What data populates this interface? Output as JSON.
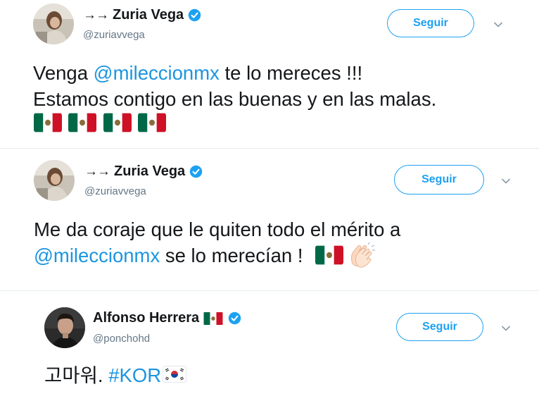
{
  "tweets": [
    {
      "prefix": "→→",
      "name": "Zuria Vega",
      "handle": "@zuriavvega",
      "follow_label": "Seguir",
      "lines": [
        {
          "parts": [
            {
              "t": "Venga "
            },
            {
              "t": "@mileccionmx",
              "m": true
            },
            {
              "t": " te lo mereces !!!"
            }
          ]
        },
        {
          "parts": [
            {
              "t": "Estamos contigo en las buenas y en las malas."
            }
          ]
        }
      ],
      "flags_count": 4
    },
    {
      "prefix": "→→",
      "name": "Zuria Vega",
      "handle": "@zuriavvega",
      "follow_label": "Seguir",
      "line1": "Me da coraje que le quiten todo el mérito a",
      "line2_mention": "@mileccionmx",
      "line2_rest": " se lo merecían ! "
    },
    {
      "name": "Alfonso Herrera",
      "handle": "@ponchohd",
      "follow_label": "Seguir",
      "text_plain": "고마워. ",
      "hashtag": "#KOR"
    }
  ],
  "colors": {
    "accent": "#1da1f2",
    "mention": "#1b95e0",
    "handle": "#657786",
    "divider": "#e6ecf0"
  },
  "icons": [
    "verified-badge-icon",
    "chevron-down-icon",
    "mexico-flag-icon",
    "clapping-hands-icon",
    "south-korea-flag-icon"
  ]
}
